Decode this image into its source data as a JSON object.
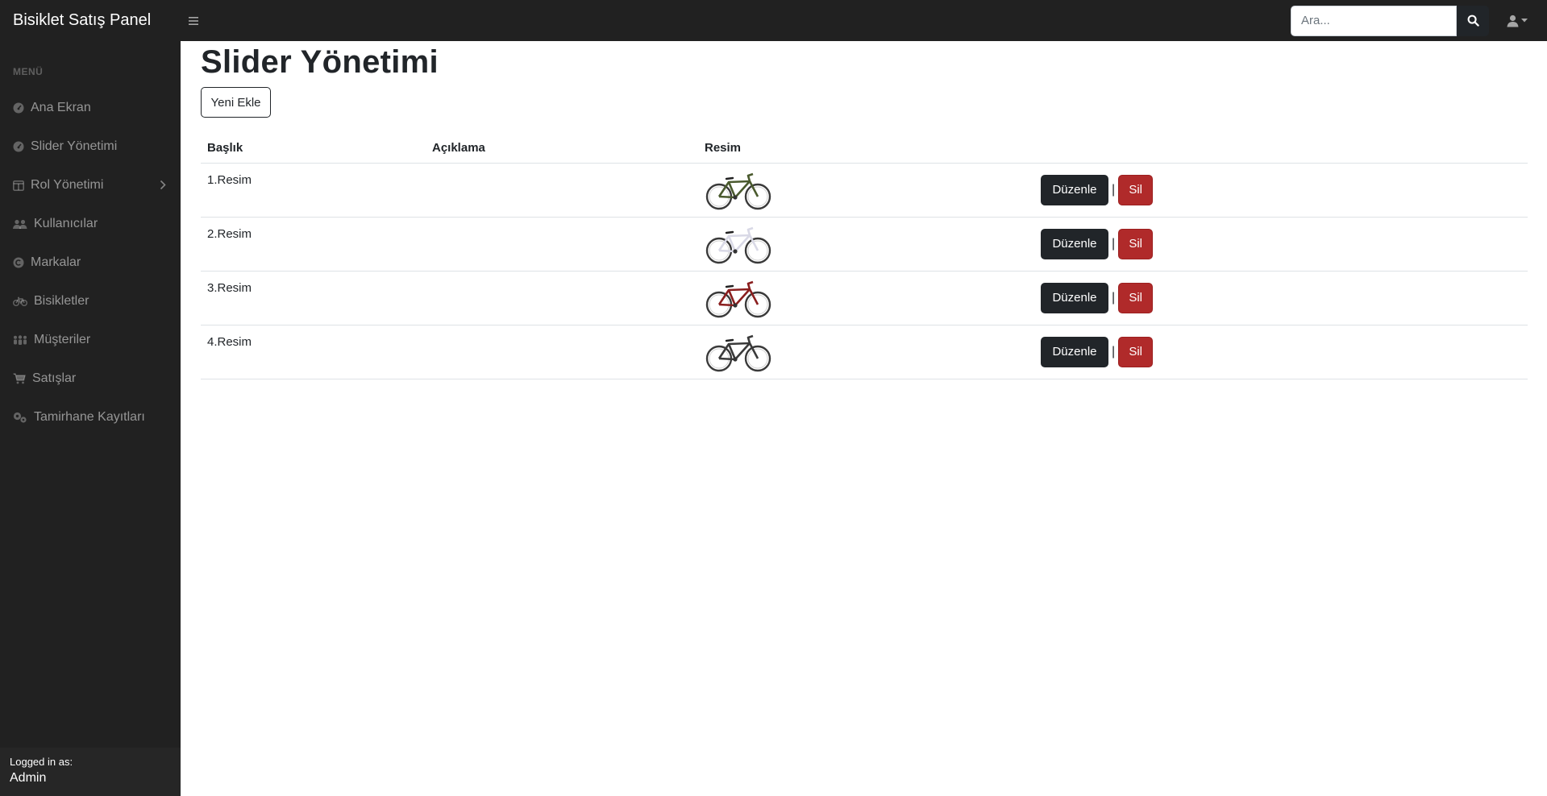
{
  "brand": "Bisiklet Satış Panel",
  "search": {
    "placeholder": "Ara..."
  },
  "sidebar": {
    "heading": "MENÜ",
    "items": [
      {
        "label": "Ana Ekran",
        "icon": "gauge-icon"
      },
      {
        "label": "Slider Yönetimi",
        "icon": "gauge-icon"
      },
      {
        "label": "Rol Yönetimi",
        "icon": "columns-icon"
      },
      {
        "label": "Kullanıcılar",
        "icon": "users-icon"
      },
      {
        "label": "Markalar",
        "icon": "copyright-icon"
      },
      {
        "label": "Bisikletler",
        "icon": "bicycle-icon"
      },
      {
        "label": "Müşteriler",
        "icon": "people-group-icon"
      },
      {
        "label": "Satışlar",
        "icon": "cart-icon"
      },
      {
        "label": "Tamirhane Kayıtları",
        "icon": "gears-icon"
      }
    ],
    "footer": {
      "logged_in_label": "Logged in as:",
      "user": "Admin"
    }
  },
  "main": {
    "title": "Slider Yönetimi",
    "new_button": "Yeni Ekle",
    "columns": [
      "Başlık",
      "Açıklama",
      "Resim"
    ],
    "rows": [
      {
        "title": "1.Resim",
        "description": "",
        "bike_color": "#4a5a2e"
      },
      {
        "title": "2.Resim",
        "description": "",
        "bike_color": "#d9d9e6"
      },
      {
        "title": "3.Resim",
        "description": "",
        "bike_color": "#8a1e1e"
      },
      {
        "title": "4.Resim",
        "description": "",
        "bike_color": "#3a3a3a"
      }
    ],
    "edit_label": "Düzenle",
    "separator": "|",
    "delete_label": "Sil"
  },
  "colors": {
    "navbar": "#212121",
    "danger": "#b02a2a",
    "dark": "#212529"
  }
}
